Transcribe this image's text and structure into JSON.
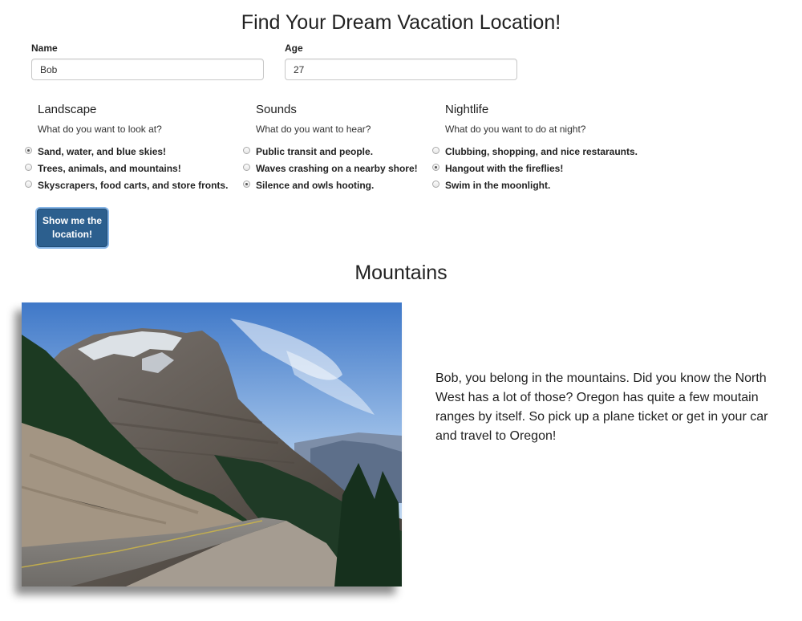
{
  "page": {
    "title": "Find Your Dream Vacation Location!"
  },
  "form": {
    "name": {
      "label": "Name",
      "value": "Bob"
    },
    "age": {
      "label": "Age",
      "value": "27"
    },
    "groups": [
      {
        "title": "Landscape",
        "prompt": "What do you want to look at?",
        "options": [
          {
            "label": "Sand, water, and blue skies!",
            "checked": true
          },
          {
            "label": "Trees, animals, and mountains!",
            "checked": false
          },
          {
            "label": "Skyscrapers, food carts, and store fronts.",
            "checked": false
          }
        ]
      },
      {
        "title": "Sounds",
        "prompt": "What do you want to hear?",
        "options": [
          {
            "label": "Public transit and people.",
            "checked": false
          },
          {
            "label": "Waves crashing on a nearby shore!",
            "checked": false
          },
          {
            "label": "Silence and owls hooting.",
            "checked": true
          }
        ]
      },
      {
        "title": "Nightlife",
        "prompt": "What do you want to do at night?",
        "options": [
          {
            "label": "Clubbing, shopping, and nice restaraunts.",
            "checked": false
          },
          {
            "label": "Hangout with the fireflies!",
            "checked": true
          },
          {
            "label": "Swim in the moonlight.",
            "checked": false
          }
        ]
      }
    ],
    "submit_label": "Show me the location!"
  },
  "result": {
    "title": "Mountains",
    "image_icon": "mountain-road-photo",
    "text": "Bob, you belong in the mountains. Did you know the North West has a lot of those? Oregon has quite a few moutain ranges by itself. So pick up a plane ticket or get in your car and travel to Oregon!"
  },
  "colors": {
    "button": "#2c5f8e",
    "button_focus_ring": "#86b5e6",
    "sky": "#7fa8d6"
  }
}
